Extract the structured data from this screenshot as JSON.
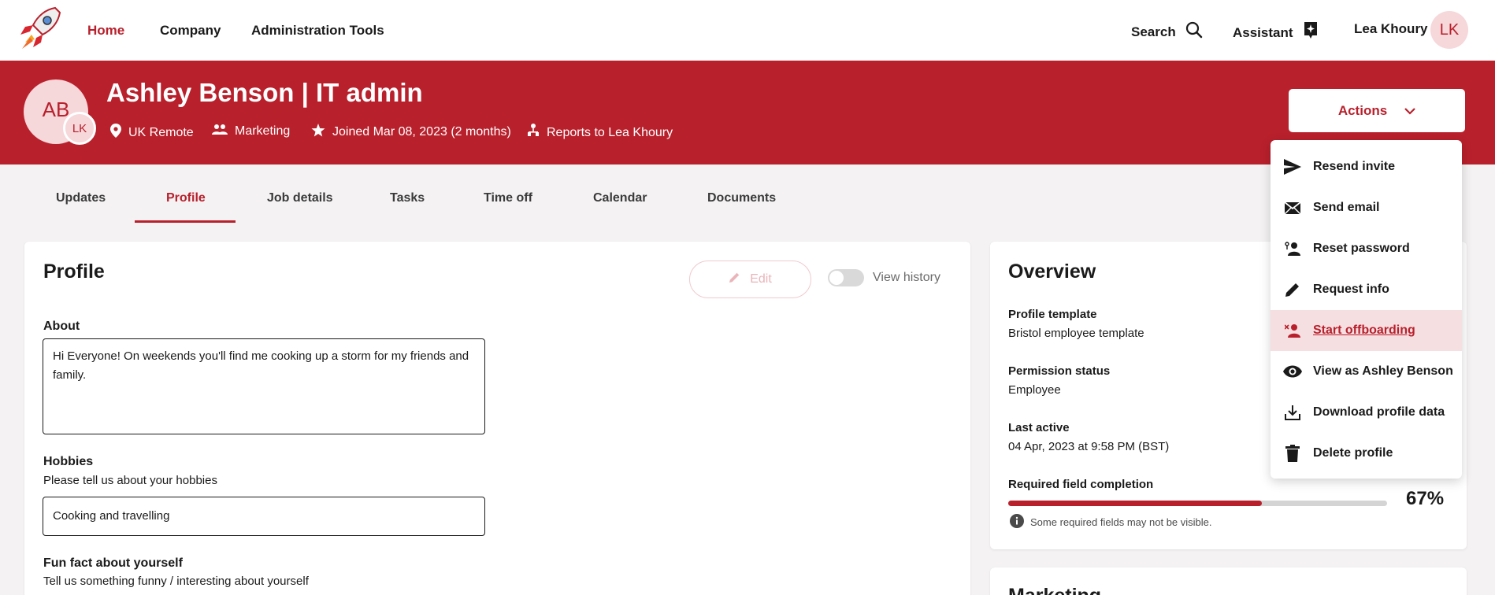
{
  "nav": {
    "links": [
      "Home",
      "Company",
      "Administration Tools"
    ],
    "search_label": "Search",
    "assistant_label": "Assistant",
    "user_name": "Lea Khoury",
    "user_initials": "LK"
  },
  "header": {
    "initials": "AB",
    "badge_initials": "LK",
    "name": "Ashley Benson | IT admin",
    "location": "UK Remote",
    "department": "Marketing",
    "joined": "Joined Mar 08, 2023 (2 months)",
    "reports_to": "Reports to Lea Khoury",
    "actions_label": "Actions"
  },
  "tabs": [
    "Updates",
    "Profile",
    "Job details",
    "Tasks",
    "Time off",
    "Calendar",
    "Documents"
  ],
  "profile": {
    "title": "Profile",
    "edit_label": "Edit",
    "view_history_label": "View history",
    "about_label": "About",
    "about_value": "Hi Everyone! On weekends you'll find me cooking up a storm for my friends and family.",
    "hobbies_label": "Hobbies",
    "hobbies_hint": "Please tell us about your hobbies",
    "hobbies_value": "Cooking and travelling",
    "fun_fact_label": "Fun fact about yourself",
    "fun_fact_hint": "Tell us something funny / interesting about yourself"
  },
  "overview": {
    "title": "Overview",
    "profile_template_label": "Profile template",
    "profile_template_value": "Bristol employee template",
    "permission_label": "Permission status",
    "permission_value": "Employee",
    "last_active_label": "Last active",
    "last_active_value": "04 Apr, 2023 at 9:58 PM (BST)",
    "completion_label": "Required field completion",
    "completion_percent": "67%",
    "completion_fraction": 0.67,
    "completion_note": "Some required fields may not be visible."
  },
  "next_card_title": "Marketing",
  "menu": {
    "items": [
      {
        "label": "Resend invite",
        "icon": "send-icon"
      },
      {
        "label": "Send email",
        "icon": "envelope-icon"
      },
      {
        "label": "Reset password",
        "icon": "user-key-icon"
      },
      {
        "label": "Request info",
        "icon": "pencil-icon"
      },
      {
        "label": "Start offboarding",
        "icon": "user-remove-icon"
      },
      {
        "label": "View as Ashley Benson",
        "icon": "eye-icon"
      },
      {
        "label": "Download profile data",
        "icon": "download-icon"
      },
      {
        "label": "Delete profile",
        "icon": "trash-icon"
      }
    ]
  },
  "colors": {
    "brand": "#b8202c",
    "brand_light": "#f6d7da"
  }
}
